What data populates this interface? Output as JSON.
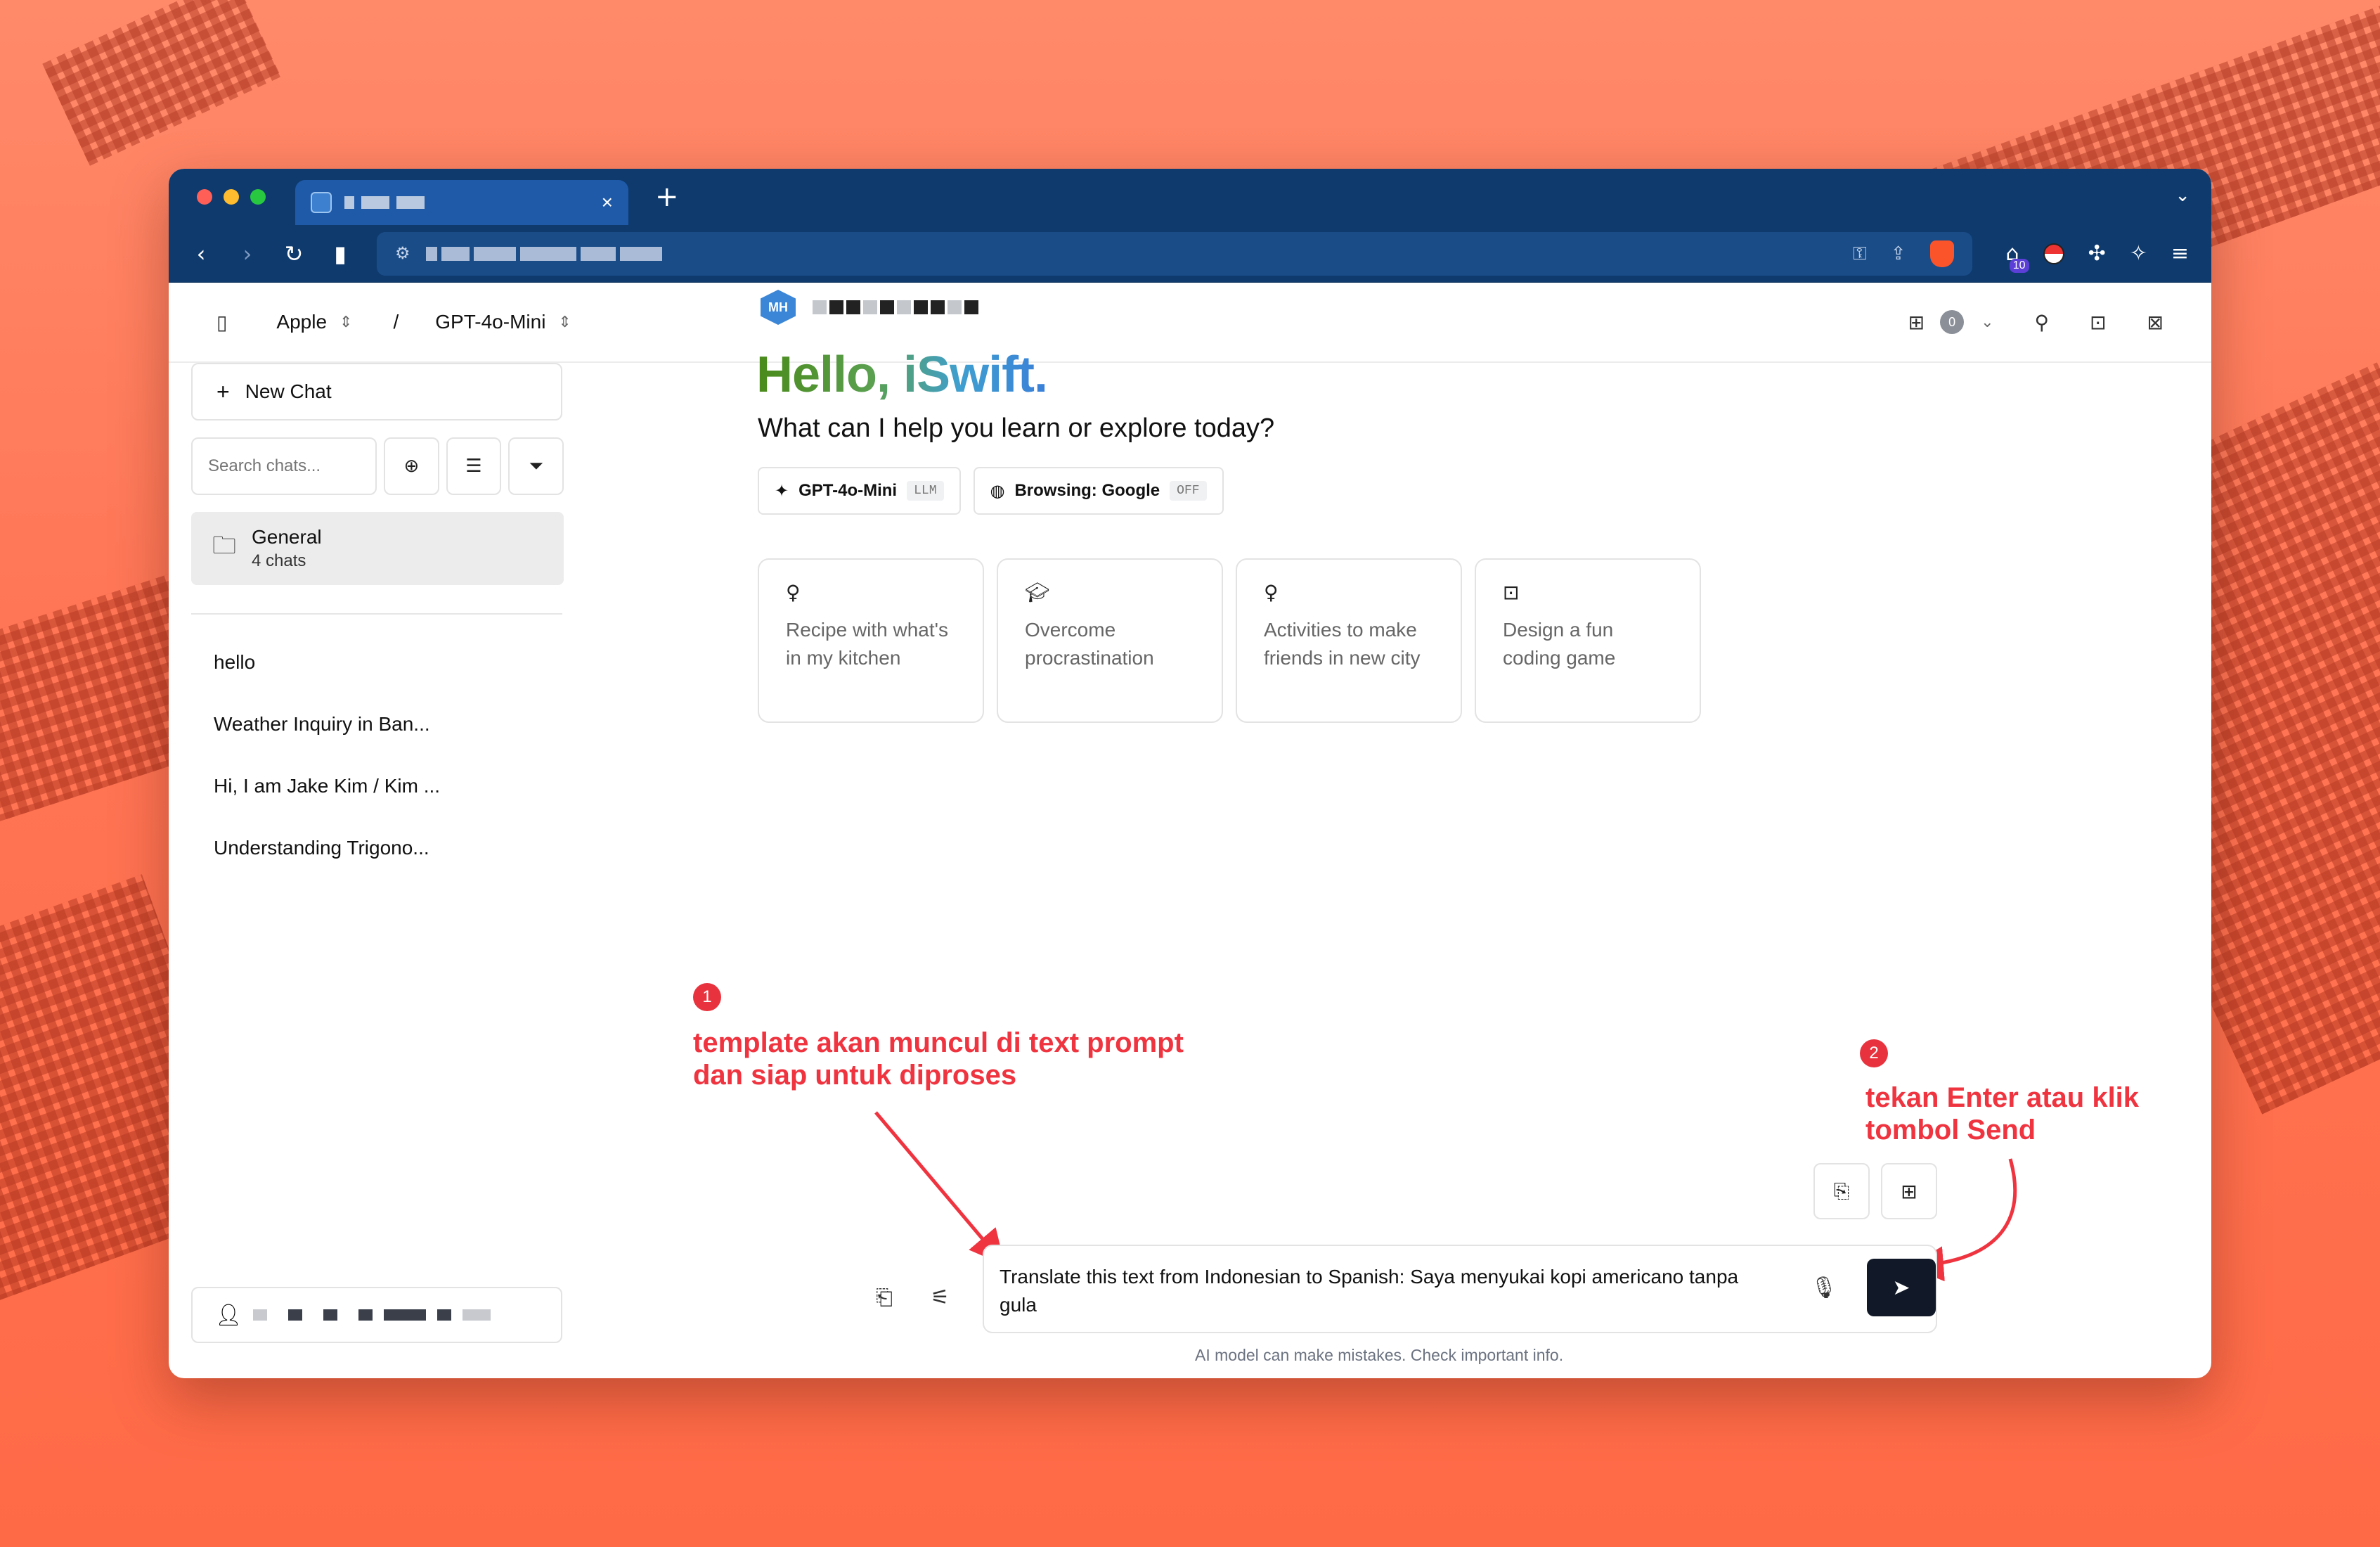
{
  "browser": {
    "tab": {
      "close": "×",
      "new_tab": "+"
    },
    "menu_chevron": "⌄"
  },
  "header": {
    "workspace": "Apple",
    "separator": "/",
    "model": "GPT-4o-Mini",
    "badge_count": "0"
  },
  "sidebar": {
    "new_chat_label": "New Chat",
    "search_placeholder": "Search chats...",
    "folder": {
      "name": "General",
      "count": "4 chats"
    },
    "chats": [
      {
        "title": "hello"
      },
      {
        "title": "Weather Inquiry in Ban..."
      },
      {
        "title": "Hi, I am Jake Kim / Kim ..."
      },
      {
        "title": "Understanding Trigono..."
      }
    ]
  },
  "main": {
    "logo_text": "MH",
    "greeting": "Hello, iSwift.",
    "subtitle": "What can I help you learn or explore today?",
    "chips": [
      {
        "label": "GPT-4o-Mini",
        "tag": "LLM",
        "icon": "sparkles-icon"
      },
      {
        "label": "Browsing: Google",
        "tag": "OFF",
        "icon": "globe-icon"
      }
    ],
    "suggestions": [
      {
        "icon": "lightbulb-icon",
        "text": "Recipe with what's in my kitchen"
      },
      {
        "icon": "graduation-cap-icon",
        "text": "Overcome procrastination"
      },
      {
        "icon": "lightbulb-icon",
        "text": "Activities to make friends in new city"
      },
      {
        "icon": "terminal-icon",
        "text": "Design a fun coding game"
      }
    ]
  },
  "composer": {
    "prompt_value": "Translate this text from Indonesian to Spanish: Saya menyukai kopi americano tanpa gula",
    "disclaimer": "AI model can make mistakes. Check important info."
  },
  "annotations": [
    {
      "number": "1",
      "text": "template akan muncul di text prompt dan siap untuk diproses"
    },
    {
      "number": "2",
      "text": "tekan Enter atau klik tombol Send"
    }
  ],
  "colors": {
    "background": "#ff7656",
    "browser_chrome": "#0e3a6e",
    "annotation": "#ef3440",
    "send_button": "#111827"
  }
}
